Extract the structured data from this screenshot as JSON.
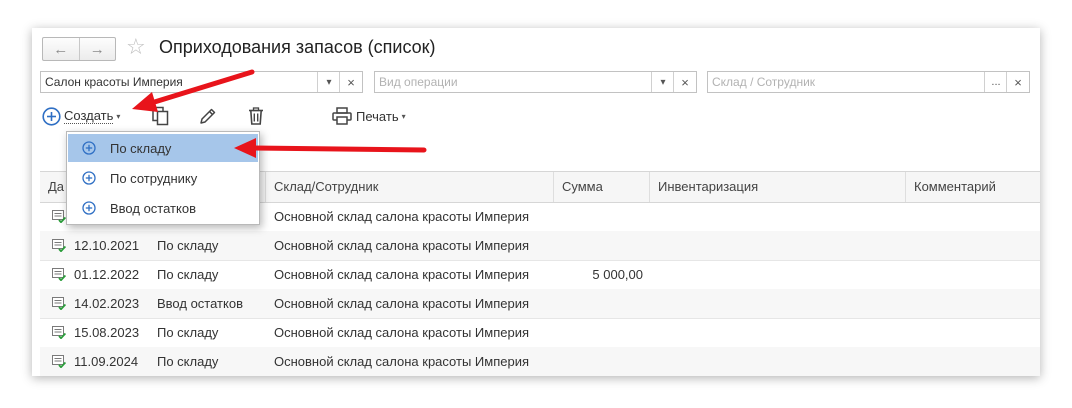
{
  "window": {
    "title": "Оприходования запасов (список)",
    "nav_back": "←",
    "nav_forward": "→",
    "favorite_star": "☆"
  },
  "filters": {
    "organization": {
      "value": "Салон красоты Империя",
      "dropdown": "▾",
      "clear": "×"
    },
    "operation": {
      "placeholder": "Вид операции",
      "dropdown": "▾",
      "clear": "×"
    },
    "warehouse": {
      "placeholder": "Склад / Сотрудник",
      "select": "...",
      "clear": "×"
    }
  },
  "toolbar": {
    "create_label": "Создать",
    "create_caret": "▾",
    "print_label": "Печать",
    "print_caret": "▾"
  },
  "create_menu": {
    "items": [
      {
        "label": "По складу",
        "selected": true
      },
      {
        "label": "По сотруднику",
        "selected": false
      },
      {
        "label": "Ввод остатков",
        "selected": false
      }
    ]
  },
  "table": {
    "columns": [
      "Да",
      "Склад/Сотрудник",
      "Сумма",
      "Инвентаризация",
      "Комментарий"
    ],
    "rows": [
      {
        "date": "",
        "type": "",
        "warehouse": "Основной склад салона красоты Империя",
        "sum": "",
        "inventory": "",
        "comment": ""
      },
      {
        "date": "12.10.2021",
        "type": "По складу",
        "warehouse": "Основной склад салона красоты Империя",
        "sum": "",
        "inventory": "",
        "comment": ""
      },
      {
        "date": "01.12.2022",
        "type": "По складу",
        "warehouse": "Основной склад салона красоты Империя",
        "sum": "5 000,00",
        "inventory": "",
        "comment": ""
      },
      {
        "date": "14.02.2023",
        "type": "Ввод остатков",
        "warehouse": "Основной склад салона красоты Империя",
        "sum": "",
        "inventory": "",
        "comment": ""
      },
      {
        "date": "15.08.2023",
        "type": "По складу",
        "warehouse": "Основной склад салона красоты Империя",
        "sum": "",
        "inventory": "",
        "comment": ""
      },
      {
        "date": "11.09.2024",
        "type": "По складу",
        "warehouse": "Основной склад салона красоты Империя",
        "sum": "",
        "inventory": "",
        "comment": ""
      }
    ]
  },
  "colors": {
    "accent_blue": "#2f6fc4",
    "menu_selected": "#a6c6ea",
    "annotation_red": "#e8141b",
    "doc_icon_green": "#2a9d3a"
  }
}
